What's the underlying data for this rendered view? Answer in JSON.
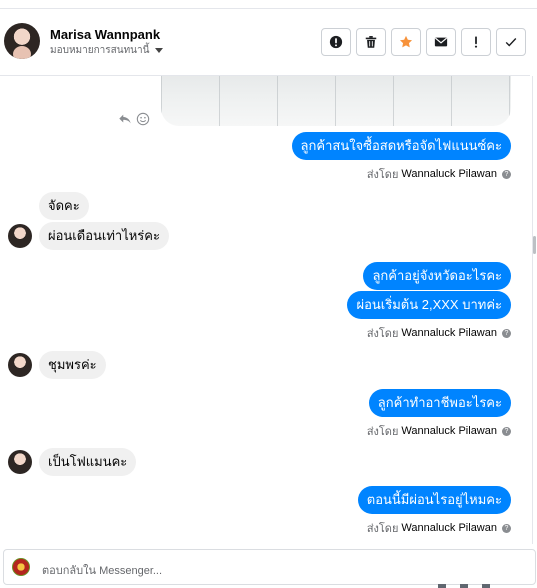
{
  "header": {
    "contact_name": "Marisa Wannpank",
    "assign_label": "มอบหมายการสนทนานี้",
    "toolbar": [
      {
        "name": "spam-button",
        "icon": "alert-circle-icon"
      },
      {
        "name": "delete-button",
        "icon": "trash-icon"
      },
      {
        "name": "star-button",
        "icon": "star-icon"
      },
      {
        "name": "mark-unread-button",
        "icon": "envelope-icon"
      },
      {
        "name": "follow-up-button",
        "icon": "exclamation-icon"
      },
      {
        "name": "done-button",
        "icon": "check-icon"
      }
    ],
    "accent_star": "#f7923a"
  },
  "messages": {
    "out1": "ลูกค้าสนใจซื้อสดหรือจัดไฟแนนซ์คะ",
    "in1a": "จัดคะ",
    "in1b": "ผ่อนเดือนเท่าไหร่คะ",
    "out2a": "ลูกค้าอยู่จังหวัดอะไรคะ",
    "out2b": "ผ่อนเริ่มต้น 2,XXX  บาทค่ะ",
    "in2": "ชุมพรค่ะ",
    "out3": "ลูกค้าทำอาชีพอะไรคะ",
    "in3": "เป็นโฟแมนคะ",
    "out4": "ตอนนี้มีผ่อนไรอยู่ไหมคะ"
  },
  "sent_by": {
    "prefix": "ส่งโดย",
    "agent": "Wannaluck Pilawan"
  },
  "reply": {
    "placeholder": "ตอบกลับใน Messenger..."
  },
  "colors": {
    "outgoing_bubble": "#0084ff",
    "incoming_bubble": "#f0f0f0"
  }
}
